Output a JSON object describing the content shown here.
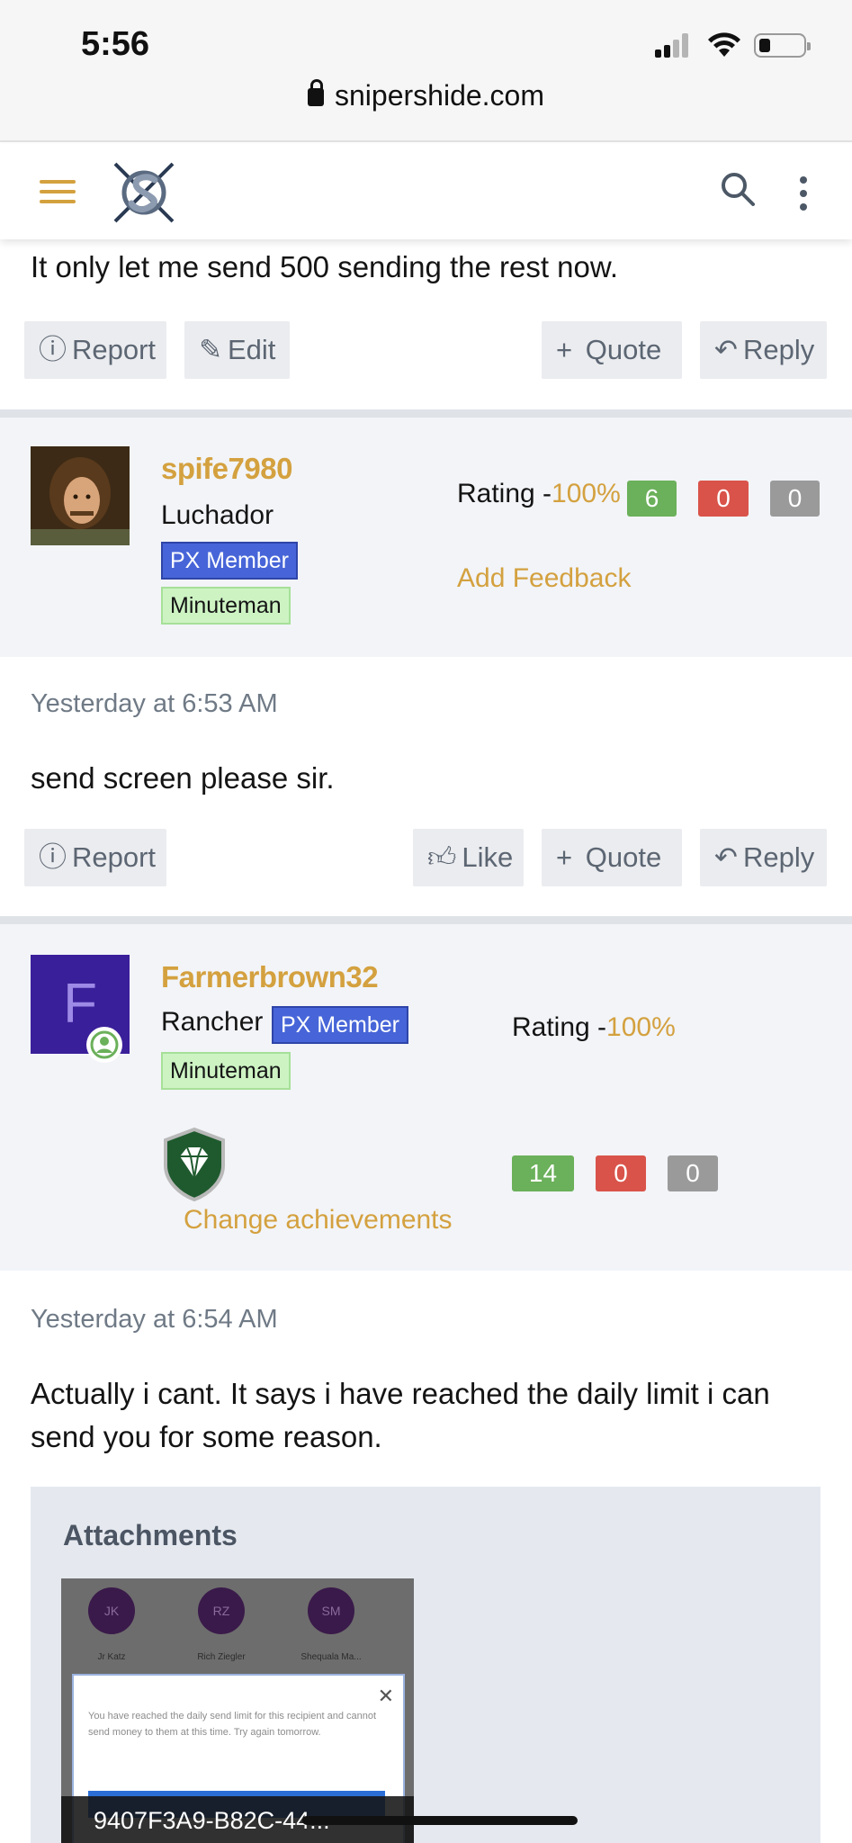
{
  "status": {
    "time": "5:56",
    "url": "snipershide.com"
  },
  "header": {
    "menu_icon": "hamburger-icon",
    "logo": "snipershide-logo",
    "search_icon": "search-icon",
    "more_icon": "kebab-icon"
  },
  "post0": {
    "text": "It only let me send 500 sending the rest now.",
    "actions": {
      "report": "Report",
      "edit": "Edit",
      "quote": "Quote",
      "reply": "Reply"
    }
  },
  "post1": {
    "user": {
      "name": "spife7980",
      "title": "Luchador",
      "badge_px": "PX Member",
      "badge_rank": "Minuteman"
    },
    "rating": {
      "label": "Rating -",
      "pct": "100%",
      "positive": "6",
      "negative": "0",
      "neutral": "0",
      "add_feedback": "Add Feedback"
    },
    "timestamp": "Yesterday at 6:53 AM",
    "text": "send screen please sir.",
    "actions": {
      "report": "Report",
      "like": "Like",
      "quote": "Quote",
      "reply": "Reply"
    }
  },
  "post2": {
    "user": {
      "initial": "F",
      "name": "Farmerbrown32",
      "title": "Rancher",
      "badge_px": "PX Member",
      "badge_rank": "Minuteman"
    },
    "rating": {
      "label": "Rating -",
      "pct": "100%",
      "positive": "14",
      "negative": "0",
      "neutral": "0"
    },
    "change_achievements": "Change achievements",
    "timestamp": "Yesterday at 6:54 AM",
    "text": "Actually i cant. It says i have reached the daily limit i can send you for some reason.",
    "attachments": {
      "title": "Attachments",
      "thumb_initials": [
        "JK",
        "RZ",
        "SM"
      ],
      "thumb_names": [
        "Jr Katz",
        "Rich Ziegler",
        "Shequala Ma..."
      ],
      "thumb_message": "You have reached the daily send limit for this recipient and cannot send money to them at this time. Try again tomorrow.",
      "caption": "9407F3A9-B82C-44..."
    }
  },
  "colors": {
    "accent": "#d4a13f",
    "px_badge": "#4765d8",
    "minuteman_badge": "#cdf3c3",
    "positive": "#6bb05a",
    "negative": "#d9534a",
    "neutral": "#9a9a9a",
    "avatar_f": "#3a1f9a"
  }
}
